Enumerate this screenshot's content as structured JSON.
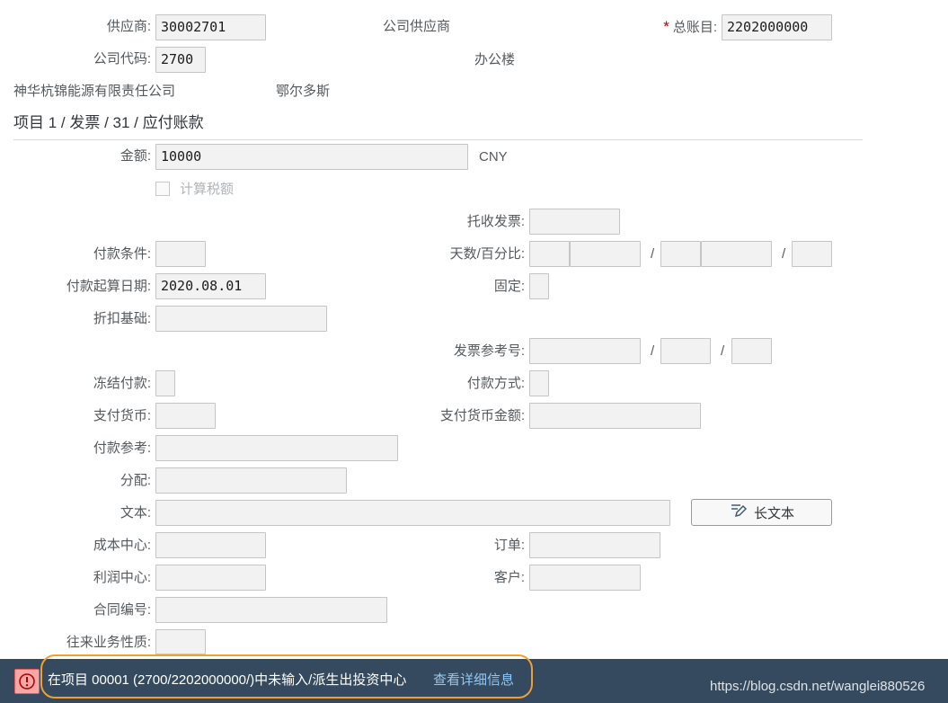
{
  "header": {
    "vendor_label": "供应商:",
    "vendor_value": "30002701",
    "vendor_name_tail": "公司供应商",
    "gl_required_mark": "*",
    "gl_label": "总账目:",
    "gl_value": "2202000000",
    "company_code_label": "公司代码:",
    "company_code_value": "2700",
    "company_name_tail": "办公楼",
    "company_full_name": "神华杭锦能源有限责任公司",
    "city": "鄂尔多斯"
  },
  "section": {
    "title": "项目 1 / 发票 / 31 / 应付账款"
  },
  "form": {
    "amount_label": "金额:",
    "amount_value": "10000",
    "currency": "CNY",
    "calc_tax_label": "计算税额",
    "collection_invoice_label": "托收发票:",
    "payment_terms_label": "付款条件:",
    "days_percent_label": "天数/百分比:",
    "baseline_date_label": "付款起算日期:",
    "baseline_date_value": "2020.08.01",
    "fixed_label": "固定:",
    "discount_base_label": "折扣基础:",
    "invoice_ref_label": "发票参考号:",
    "payment_block_label": "冻结付款:",
    "payment_method_label": "付款方式:",
    "payment_currency_label": "支付货币:",
    "payment_currency_amount_label": "支付货币金额:",
    "payment_reference_label": "付款参考:",
    "assignment_label": "分配:",
    "text_label": "文本:",
    "long_text_button": "长文本",
    "cost_center_label": "成本中心:",
    "order_label": "订单:",
    "profit_center_label": "利润中心:",
    "customer_label": "客户:",
    "contract_no_label": "合同编号:",
    "transaction_type_label": "往来业务性质:",
    "slash": "/"
  },
  "message": {
    "text": "在项目 00001 (2700/2202000000/)中未输入/派生出投资中心",
    "link": "查看详细信息",
    "error_icon_glyph": "!"
  },
  "watermark": "https://blog.csdn.net/wanglei880526",
  "colors": {
    "message_bar": "#354a5f",
    "error_icon_bg": "#f8a7a7",
    "link": "#91c8f6",
    "required": "#bb0000",
    "highlight_ring": "#f0a030"
  }
}
